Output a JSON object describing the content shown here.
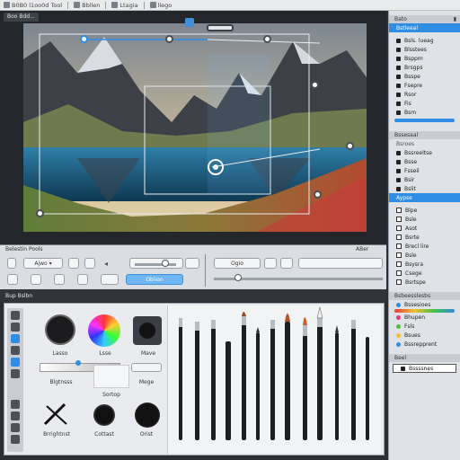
{
  "menubar": {
    "items": [
      "B0B0 l1oo0d Tool",
      "Bbllen",
      "Ltagia",
      "llego"
    ]
  },
  "canvas": {
    "doc_tab": "Boo Bdd..."
  },
  "right_panel": {
    "top_label": "Bato",
    "group1": {
      "selected": "Bstleeal",
      "items": [
        "Bsls. lueag",
        "Blsstees",
        "Bsppm",
        "Brsgps",
        "Bsspe",
        "Fsepre",
        "Rsor",
        "Fis",
        "Bsm"
      ]
    },
    "group2": {
      "head": "Bssesaal",
      "sub": "Bsroes",
      "items": [
        "Bssreeltse",
        "Bsse",
        "Fsseil",
        "Bsir",
        "Bslit"
      ],
      "selected": "Aypse"
    },
    "group3": {
      "items": [
        "Blpe",
        "Bsle",
        "Asot",
        "Bsrte",
        "Brecl lire",
        "Bsle",
        "Bsysra",
        "Csege",
        "Bsrtspe"
      ]
    },
    "group4": {
      "head": "Bsbeesslesbs",
      "items": [
        "Bssesioes",
        "Bhupen",
        "Fsls",
        "Bsues",
        "Bssrepprent"
      ]
    },
    "group5": {
      "head": "Beel",
      "item": "Bssssnes"
    },
    "colors": {
      "accent": "#2f8de4"
    }
  },
  "mid_toolbar": {
    "title": "Belestin Pools",
    "right_label": "ABer",
    "btn_mode": "Ajwo",
    "btn_ops": "Ogio",
    "btn_option": "Oblion"
  },
  "brush_panel": {
    "title": "Bup Bslbn",
    "labels": {
      "lasso": "Lasso",
      "color": "Lsse",
      "move": "Mave",
      "brightness": "Blgtnsss",
      "sortop": "Sortop",
      "mage": "Mege",
      "brightnest": "Brrightnst",
      "contrast": "Cottast",
      "orist": "Orist"
    }
  }
}
